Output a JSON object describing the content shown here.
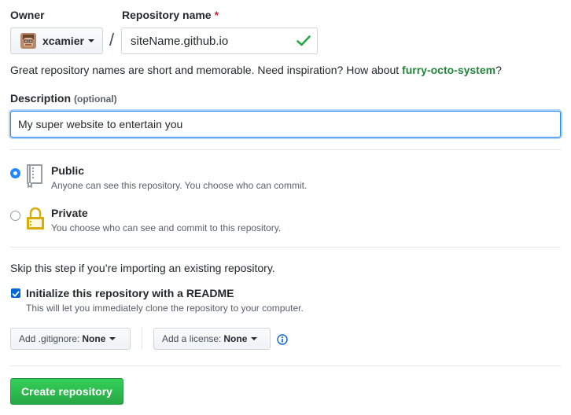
{
  "owner": {
    "label": "Owner",
    "selected": "xcamier"
  },
  "repository": {
    "label": "Repository name",
    "required_mark": "*",
    "value": "siteName.github.io",
    "separator": "/"
  },
  "hint": {
    "text": "Great repository names are short and memorable. Need inspiration? How about ",
    "suggestion": "furry-octo-system",
    "suffix": "?"
  },
  "description": {
    "label": "Description",
    "optional": "(optional)",
    "value": "My super website to entertain you"
  },
  "visibility": {
    "public": {
      "title": "Public",
      "subtitle": "Anyone can see this repository. You choose who can commit.",
      "checked": true
    },
    "private": {
      "title": "Private",
      "subtitle": "You choose who can see and commit to this repository.",
      "checked": false
    }
  },
  "init": {
    "skip_text": "Skip this step if you’re importing an existing repository.",
    "readme_label": "Initialize this repository with a README",
    "readme_sub": "This will let you immediately clone the repository to your computer.",
    "readme_checked": true
  },
  "gitignore": {
    "label": "Add .gitignore:",
    "value": "None"
  },
  "license": {
    "label": "Add a license:",
    "value": "None"
  },
  "submit": {
    "label": "Create repository"
  },
  "colors": {
    "accent_blue": "#2188ff",
    "success_green": "#28a745",
    "suggestion_green": "#22863a",
    "required_red": "#cb2431",
    "icon_gray": "#959da5",
    "lock_gold": "#dbab09"
  }
}
